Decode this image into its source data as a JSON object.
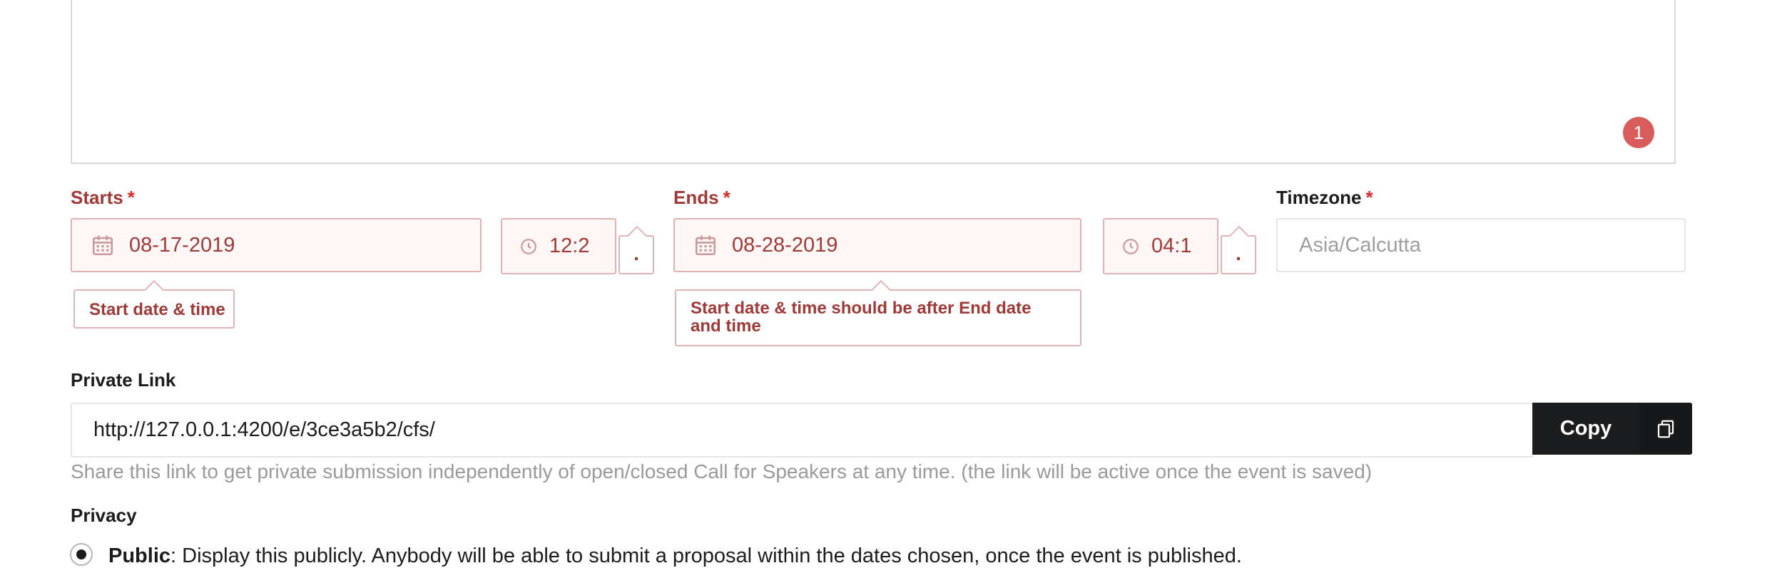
{
  "description_area": {
    "badge_count": "1"
  },
  "starts": {
    "label": "Starts",
    "required": "*",
    "date_value": "08-17-2019",
    "time_value": "12:2",
    "ampm_value": ".",
    "error_prompt": "Start date & time"
  },
  "ends": {
    "label": "Ends",
    "required": "*",
    "date_value": "08-28-2019",
    "time_value": "04:1",
    "ampm_value": ".",
    "error_prompt": "Start date & time should be after End date and time"
  },
  "timezone": {
    "label": "Timezone",
    "required": "*",
    "value": "Asia/Calcutta"
  },
  "private_link": {
    "label": "Private Link",
    "url": "http://127.0.0.1:4200/e/3ce3a5b2/cfs/",
    "copy_label": "Copy",
    "help": "Share this link to get private submission independently of open/closed Call for Speakers at any time. (the link will be active once the event is saved)"
  },
  "privacy": {
    "label": "Privacy",
    "option_public_title": "Public",
    "option_public_text": "Display this publicly. Anybody will be able to submit a proposal within the dates chosen, once the event is published."
  },
  "colors": {
    "error_text": "#9f3a38",
    "error_border": "#e0b4b4",
    "error_bg": "#fff6f6",
    "badge": "#d95c5c",
    "button": "#1b1c1d"
  },
  "icons": {
    "date": "calendar-icon",
    "time": "clock-icon",
    "copy": "copy-icon"
  }
}
